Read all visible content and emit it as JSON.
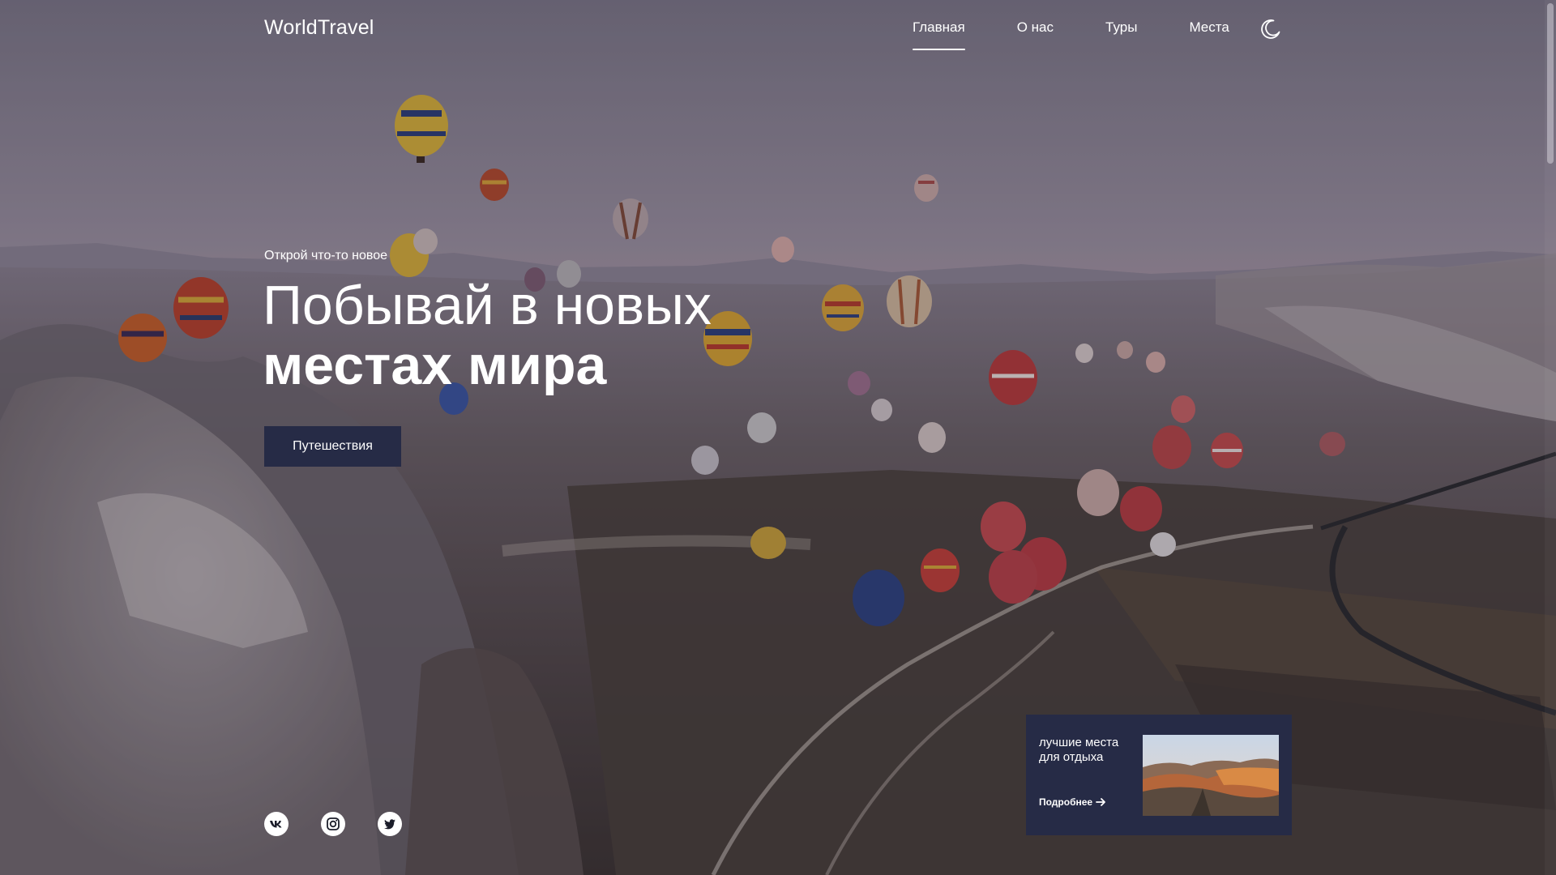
{
  "header": {
    "logo": "WorldTravel",
    "nav": [
      {
        "label": "Главная",
        "active": true
      },
      {
        "label": "О нас",
        "active": false
      },
      {
        "label": "Туры",
        "active": false
      },
      {
        "label": "Места",
        "active": false
      }
    ],
    "theme_icon": "moon-icon"
  },
  "hero": {
    "eyebrow": "Открой что-то новое",
    "title_line1": "Побывай в новых",
    "title_line2": "местах мира",
    "cta_label": "Путешествия"
  },
  "socials": [
    {
      "icon": "vk-icon"
    },
    {
      "icon": "instagram-icon"
    },
    {
      "icon": "twitter-icon"
    }
  ],
  "promo": {
    "title": "лучшие места для отдыха",
    "link_label": "Подробнее",
    "link_icon": "arrow-right-icon"
  },
  "colors": {
    "accent": "#262b46",
    "text": "#ffffff"
  }
}
